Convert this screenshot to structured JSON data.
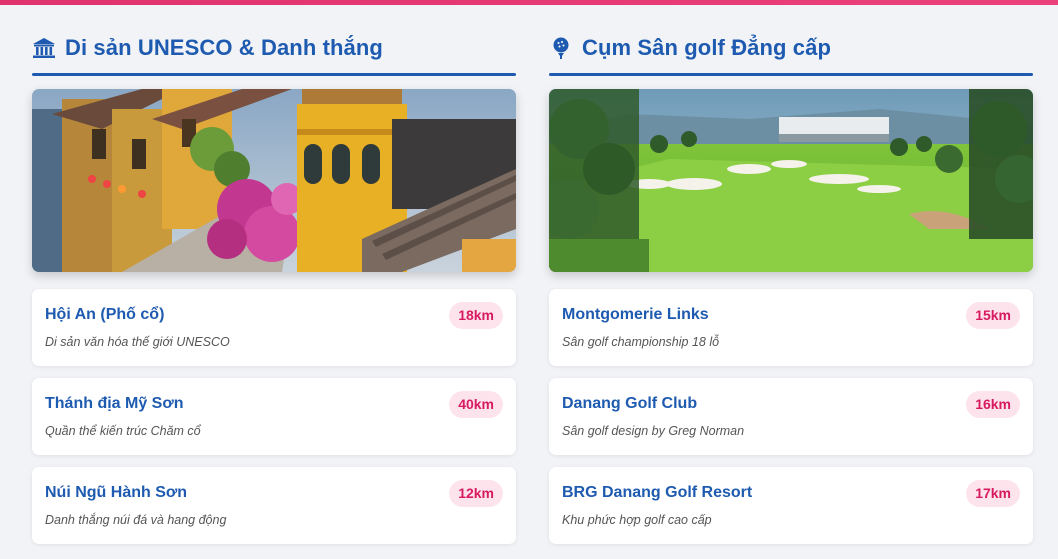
{
  "colors": {
    "accent": "#1e5bb0",
    "badge_text": "#d81b60",
    "badge_bg": "#fde4ec",
    "top_bar": "#e0336e"
  },
  "left": {
    "icon": "landmark-icon",
    "title": "Di sản UNESCO & Danh thắng",
    "image": "hoi-an-old-town-photo",
    "items": [
      {
        "name": "Hội An (Phố cổ)",
        "desc": "Di sản văn hóa thế giới UNESCO",
        "distance": "18km"
      },
      {
        "name": "Thánh địa Mỹ Sơn",
        "desc": "Quần thể kiến trúc Chăm cổ",
        "distance": "40km"
      },
      {
        "name": "Núi Ngũ Hành Sơn",
        "desc": "Danh thắng núi đá và hang động",
        "distance": "12km"
      }
    ]
  },
  "right": {
    "icon": "golf-ball-icon",
    "title": "Cụm Sân golf Đẳng cấp",
    "image": "golf-course-photo",
    "items": [
      {
        "name": "Montgomerie Links",
        "desc": "Sân golf championship 18 lỗ",
        "distance": "15km"
      },
      {
        "name": "Danang Golf Club",
        "desc": "Sân golf design by Greg Norman",
        "distance": "16km"
      },
      {
        "name": "BRG Danang Golf Resort",
        "desc": "Khu phức hợp golf cao cấp",
        "distance": "17km"
      }
    ]
  }
}
